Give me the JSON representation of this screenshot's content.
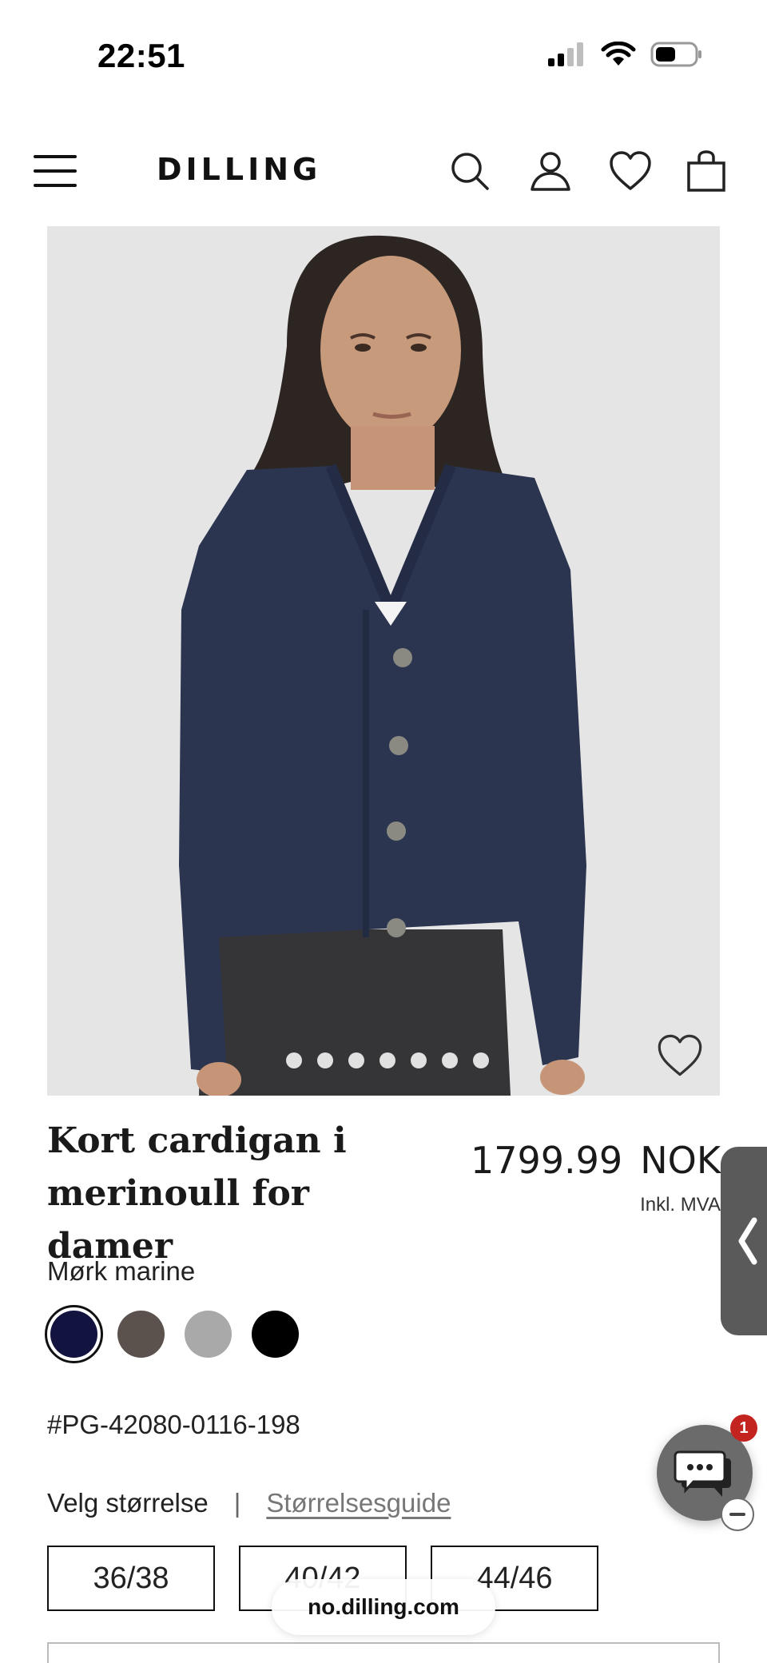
{
  "status_bar": {
    "time": "22:51"
  },
  "header": {
    "logo": "DILLING",
    "icons": [
      "menu-icon",
      "search-icon",
      "user-icon",
      "heart-icon",
      "bag-icon"
    ]
  },
  "product": {
    "image_alt": "Kort cardigan i merinoull for damer",
    "carousel_dots": 7,
    "title": "Kort cardigan i merinoull for damer",
    "price": "1799.99",
    "currency": "NOK",
    "vat_note": "Inkl. MVA",
    "color_name": "Mørk marine",
    "swatches": [
      {
        "color": "#12143f",
        "selected": true
      },
      {
        "color": "#5b524d",
        "selected": false
      },
      {
        "color": "#a9a9a9",
        "selected": false
      },
      {
        "color": "#000000",
        "selected": false
      }
    ],
    "sku": "#PG-42080-0116-198",
    "size_label": "Velg størrelse",
    "size_separator": "|",
    "size_guide": "Størrelsesguide",
    "sizes": [
      "36/38",
      "40/42",
      "44/46"
    ]
  },
  "chat": {
    "badge_count": "1"
  },
  "browser": {
    "url": "no.dilling.com"
  }
}
